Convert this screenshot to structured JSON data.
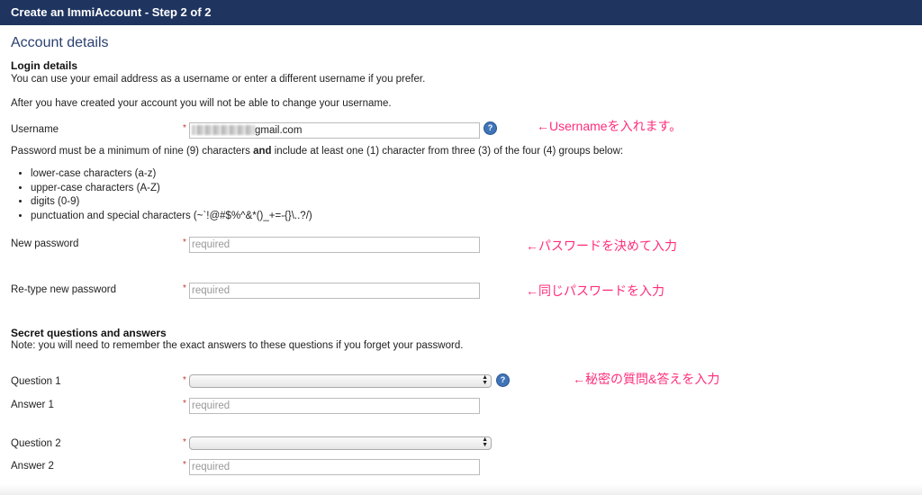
{
  "header": {
    "title": "Create an ImmiAccount - Step 2 of 2"
  },
  "section_title": "Account details",
  "login": {
    "heading": "Login details",
    "intro1": "You can use your email address as a username or enter a different username if you prefer.",
    "intro2": "After you have created your account you will not be able to change your username.",
    "username_label": "Username",
    "username_value": "gmail.com",
    "password_rule_before": "Password must be a minimum of nine (9) characters ",
    "password_rule_bold": "and",
    "password_rule_after": " include at least one (1) character from three (3) of the four (4) groups below:",
    "groups": [
      "lower-case characters (a-z)",
      "upper-case characters (A-Z)",
      "digits (0-9)",
      "punctuation and special characters (~`!@#$%^&*()_+=-{}\\..?/)"
    ],
    "new_password_label": "New password",
    "retype_password_label": "Re-type new password"
  },
  "secret": {
    "heading": "Secret questions and answers",
    "note": "Note: you will need to remember the exact answers to these questions if you forget your password.",
    "question1_label": "Question 1",
    "answer1_label": "Answer 1",
    "question2_label": "Question 2",
    "answer2_label": "Answer 2"
  },
  "required_marker": "*",
  "placeholder": "required",
  "help_glyph": "?",
  "annotations": {
    "username": "←Usernameを入れます。",
    "new_password": "←パスワードを決めて入力",
    "retype": "←同じパスワードを入力",
    "questions": "←秘密の質問&答えを入力"
  },
  "colors": {
    "header_bg": "#1f3560",
    "accent_text": "#2a3f70",
    "annotation": "#ff2d7a",
    "required": "#c0392b",
    "help_icon": "#3f74b9"
  },
  "icons": {
    "help": "question-circle-icon",
    "select_arrows": "updown-arrows-icon"
  }
}
